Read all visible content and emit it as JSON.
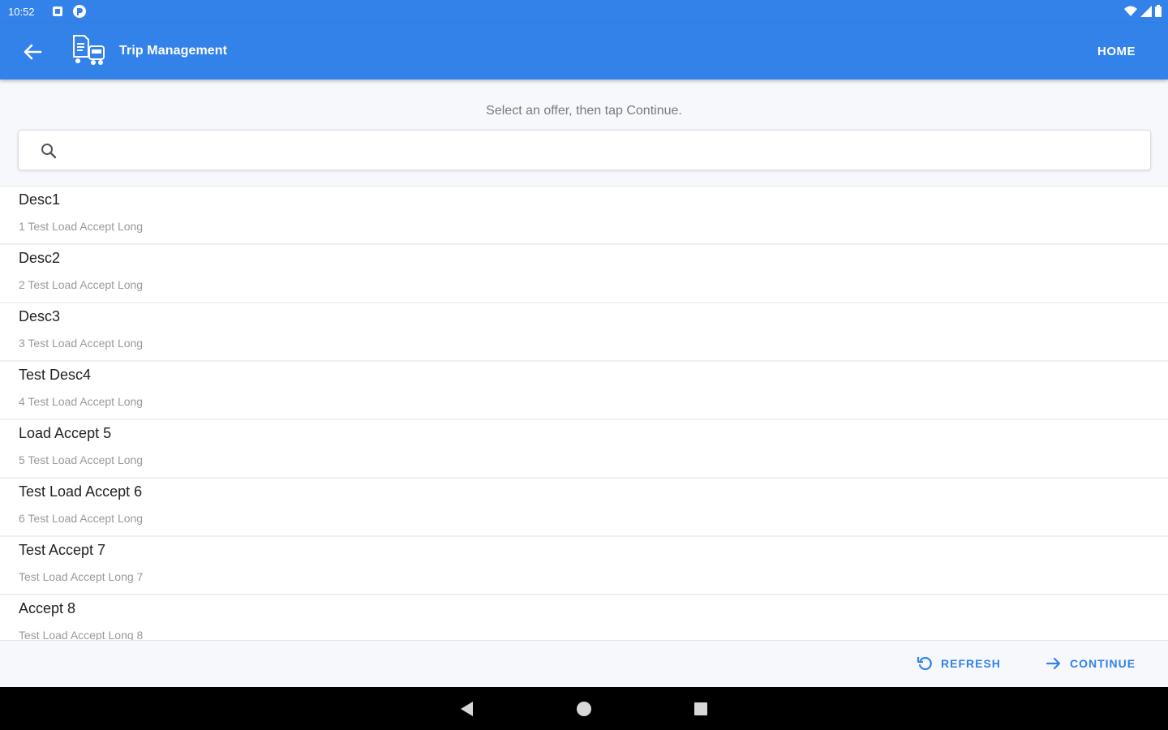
{
  "status_bar": {
    "time": "10:52"
  },
  "app_bar": {
    "title": "Trip Management",
    "home_label": "HOME"
  },
  "instruction": "Select an offer, then tap Continue.",
  "search": {
    "placeholder": ""
  },
  "offers": [
    {
      "title": "Desc1",
      "subtitle": "1 Test Load Accept Long"
    },
    {
      "title": "Desc2",
      "subtitle": "2 Test Load Accept Long"
    },
    {
      "title": "Desc3",
      "subtitle": "3 Test Load Accept Long"
    },
    {
      "title": "Test Desc4",
      "subtitle": "4 Test Load Accept Long"
    },
    {
      "title": "Load Accept 5",
      "subtitle": "5 Test Load Accept Long"
    },
    {
      "title": "Test Load Accept 6",
      "subtitle": "6 Test Load Accept Long"
    },
    {
      "title": "Test Accept 7",
      "subtitle": "Test Load Accept Long 7"
    },
    {
      "title": "Accept 8",
      "subtitle": "Test Load Accept Long 8"
    }
  ],
  "actions": {
    "refresh_label": "REFRESH",
    "continue_label": "CONTINUE"
  },
  "colors": {
    "primary": "#3382ea",
    "background": "#f6f8fc",
    "nav_bar": "#000000"
  },
  "icons": {
    "status": [
      "notification-icon",
      "pocket-icon",
      "wifi-icon",
      "signal-icon",
      "battery-icon"
    ],
    "app_bar": [
      "back-arrow-icon",
      "truck-document-icon"
    ],
    "search": "search-icon",
    "actions": [
      "refresh-icon",
      "arrow-right-icon"
    ],
    "nav": [
      "nav-back-icon",
      "nav-home-icon",
      "nav-recents-icon"
    ]
  }
}
